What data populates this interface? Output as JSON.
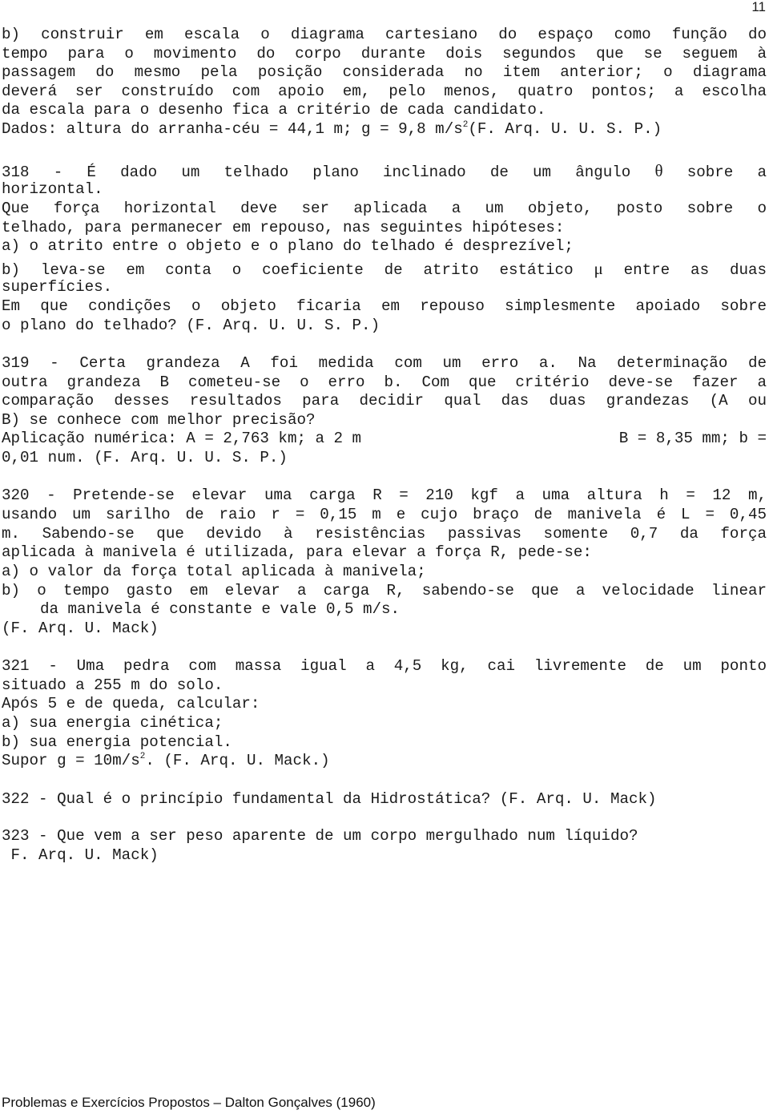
{
  "page_number": "11",
  "continuation": {
    "lines": [
      "b) construir em escala o diagrama cartesiano do espaço como função do",
      "tempo para o movimento do corpo durante dois segundos que se seguem à",
      "passagem do mesmo pela posição considerada no item anterior; o diagrama",
      "deverá ser construído com apoio em, pelo menos, quatro pontos; a escolha",
      "da escala para o desenho fica a critério de cada candidato."
    ],
    "data_line": {
      "before_sup": "Dados: altura do arranha-céu = 44,1 m; g = 9,8 m/s",
      "sup": "2",
      "after_sup": "(F. Arq. U. U. S. P.)"
    }
  },
  "problems": {
    "p318": {
      "line1_before_symbol": "318 - É dado um telhado plano inclinado de um ângulo",
      "symbol_theta": "θ",
      "line1_after_symbol": "sobre a",
      "line2": "horizontal.",
      "line3": "Que força horizontal deve ser aplicada a um objeto, posto sobre o",
      "line4": "telhado, para permanecer em repouso, nas seguintes hipóteses:",
      "line5": "a) o atrito entre o objeto e o plano do telhado é desprezível;",
      "line6_before_symbol": "b) leva-se em conta o coeficiente de atrito estático",
      "symbol_mu": "μ",
      "line6_after_symbol": "entre as duas",
      "line7": "superfícies.",
      "line8": "Em que condições o objeto ficaria em repouso simplesmente apoiado sobre",
      "line9": "o plano do telhado? (F. Arq. U. U. S. P.)"
    },
    "p319": {
      "line1": "319 - Certa grandeza A foi medida com um erro a. Na determinação de",
      "line2": "outra grandeza B cometeu-se o erro b. Com que critério deve-se fazer a",
      "line3": "comparação desses resultados para decidir qual das duas grandezas (A ou",
      "line4": "B) se conhece com melhor precisão?",
      "line5_left": "Aplicação numérica: A = 2,763 km; a 2 m",
      "line5_right": "B = 8,35 mm; b =",
      "line6": "0,01 num. (F. Arq. U. U. S. P.)"
    },
    "p320": {
      "line1": "320 - Pretende-se elevar uma carga R = 210 kgf a uma altura h = 12 m,",
      "line2": "usando um sarilho de raio r = 0,15 m e cujo braço de manivela é L = 0,45",
      "line3": "m. Sabendo-se que devido à resistências passivas somente 0,7 da força",
      "line4": "aplicada à manivela é utilizada, para elevar a força R, pede-se:",
      "line5": "a) o valor da força total aplicada à manivela;",
      "line6": "b) o tempo gasto em elevar a carga R, sabendo-se que a velocidade linear",
      "line7": "da manivela é constante e vale 0,5 m/s.",
      "line8": "(F. Arq. U. Mack)"
    },
    "p321": {
      "line1": "321 - Uma pedra com massa igual a 4,5 kg, cai livremente de um ponto",
      "line2": "situado a 255 m do solo.",
      "line3": "Após 5 e de queda, calcular:",
      "line4": "a) sua energia cinética;",
      "line5": "b) sua energia potencial.",
      "line6_before_sup": "Supor g = 10m/s",
      "line6_sup": "2",
      "line6_after_sup": ". (F. Arq. U. Mack.)"
    },
    "p322": {
      "line1": "322 - Qual é o princípio fundamental da Hidrostática? (F. Arq. U. Mack)"
    },
    "p323": {
      "line1": "323 - Que vem a ser peso aparente de um corpo mergulhado num líquido?",
      "line2": " F. Arq. U. Mack)"
    }
  },
  "footer": "Problemas e Exercícios Propostos – Dalton Gonçalves (1960)"
}
